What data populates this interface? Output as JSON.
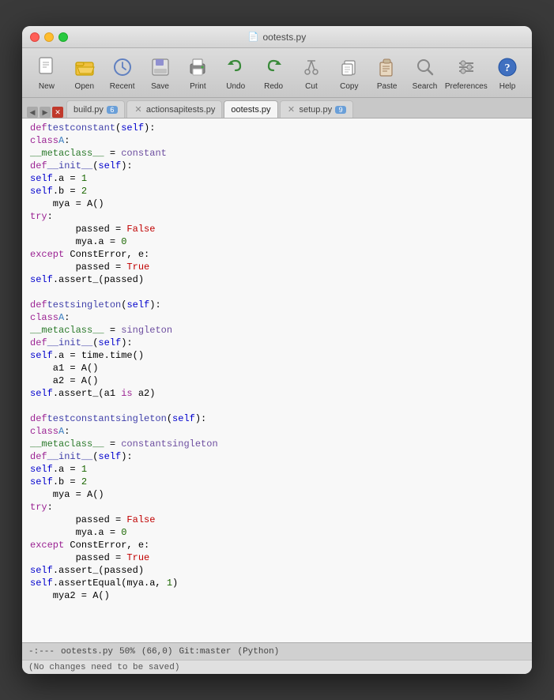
{
  "window": {
    "title": "ootests.py",
    "file_icon": "📄"
  },
  "toolbar": {
    "buttons": [
      {
        "id": "new",
        "label": "New",
        "icon": "new"
      },
      {
        "id": "open",
        "label": "Open",
        "icon": "open"
      },
      {
        "id": "recent",
        "label": "Recent",
        "icon": "recent"
      },
      {
        "id": "save",
        "label": "Save",
        "icon": "save"
      },
      {
        "id": "print",
        "label": "Print",
        "icon": "print"
      },
      {
        "id": "undo",
        "label": "Undo",
        "icon": "undo"
      },
      {
        "id": "redo",
        "label": "Redo",
        "icon": "redo"
      },
      {
        "id": "cut",
        "label": "Cut",
        "icon": "cut"
      },
      {
        "id": "copy",
        "label": "Copy",
        "icon": "copy"
      },
      {
        "id": "paste",
        "label": "Paste",
        "icon": "paste"
      },
      {
        "id": "search",
        "label": "Search",
        "icon": "search"
      },
      {
        "id": "preferences",
        "label": "Preferences",
        "icon": "preferences"
      },
      {
        "id": "help",
        "label": "Help",
        "icon": "help"
      }
    ]
  },
  "tabs": [
    {
      "id": "build",
      "label": "build.py",
      "badge": "6",
      "active": false,
      "closable": false
    },
    {
      "id": "actionsapi",
      "label": "actionsapitests.py",
      "badge": null,
      "active": false,
      "closable": true
    },
    {
      "id": "ootests",
      "label": "ootests.py",
      "badge": null,
      "active": true,
      "closable": false
    },
    {
      "id": "setup",
      "label": "setup.py",
      "badge": "9",
      "active": false,
      "closable": true
    }
  ],
  "status": {
    "mode": "-:---",
    "filename": "ootests.py",
    "percent": "50%",
    "position": "(66,0)",
    "git": "Git:master",
    "lang": "(Python)"
  },
  "minibar": {
    "message": "(No changes need to be saved)"
  },
  "code": [
    {
      "indent": 0,
      "content": "def testconstant(self):"
    },
    {
      "indent": 1,
      "content": "class A:"
    },
    {
      "indent": 2,
      "content": "__metaclass__ = constant"
    },
    {
      "indent": 2,
      "content": "def __init__(self):"
    },
    {
      "indent": 3,
      "content": "self.a = 1"
    },
    {
      "indent": 3,
      "content": "self.b = 2"
    },
    {
      "indent": 1,
      "content": "mya = A()"
    },
    {
      "indent": 1,
      "content": "try:"
    },
    {
      "indent": 2,
      "content": "passed = False"
    },
    {
      "indent": 2,
      "content": "mya.a = 0"
    },
    {
      "indent": 1,
      "content": "except ConstError, e:"
    },
    {
      "indent": 2,
      "content": "passed = True"
    },
    {
      "indent": 1,
      "content": "self.assert_(passed)"
    },
    {
      "indent": 0,
      "content": ""
    },
    {
      "indent": 0,
      "content": "def testsingleton(self):"
    },
    {
      "indent": 1,
      "content": "class A:"
    },
    {
      "indent": 2,
      "content": "__metaclass__ = singleton"
    },
    {
      "indent": 2,
      "content": "def __init__(self):"
    },
    {
      "indent": 3,
      "content": "self.a = time.time()"
    },
    {
      "indent": 1,
      "content": "a1 = A()"
    },
    {
      "indent": 1,
      "content": "a2 = A()"
    },
    {
      "indent": 1,
      "content": "self.assert_(a1 is a2)"
    },
    {
      "indent": 0,
      "content": ""
    },
    {
      "indent": 0,
      "content": "def testconstantsingleton(self):"
    },
    {
      "indent": 1,
      "content": "class A:"
    },
    {
      "indent": 2,
      "content": "__metaclass__ = constantsingleton"
    },
    {
      "indent": 2,
      "content": "def __init__(self):"
    },
    {
      "indent": 3,
      "content": "self.a = 1"
    },
    {
      "indent": 3,
      "content": "self.b = 2"
    },
    {
      "indent": 1,
      "content": "mya = A()"
    },
    {
      "indent": 1,
      "content": "try:"
    },
    {
      "indent": 2,
      "content": "passed = False"
    },
    {
      "indent": 2,
      "content": "mya.a = 0"
    },
    {
      "indent": 1,
      "content": "except ConstError, e:"
    },
    {
      "indent": 2,
      "content": "passed = True"
    },
    {
      "indent": 1,
      "content": "self.assert_(passed)"
    },
    {
      "indent": 1,
      "content": "self.assertEqual(mya.a, 1)"
    },
    {
      "indent": 1,
      "content": "mya2 = A()"
    }
  ]
}
